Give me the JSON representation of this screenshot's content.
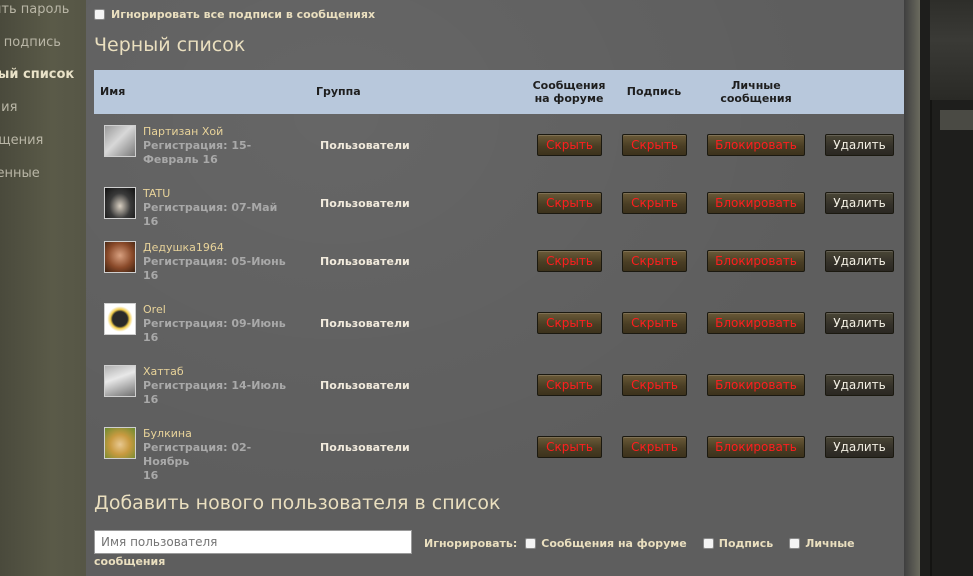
{
  "sidebar": {
    "items": [
      {
        "label": "Изменить пароль"
      },
      {
        "label": "Изменить подпись"
      },
      {
        "label": "Черный список"
      },
      {
        "label": "Уведомления"
      },
      {
        "label": "Оповещения"
      },
      {
        "label": "Сохраненные"
      }
    ]
  },
  "ignore_all_label": "Игнорировать все подписи в сообщениях",
  "blacklist": {
    "title": "Черный список",
    "headers": {
      "name": "Имя",
      "group": "Группа",
      "forum_msgs_1": "Сообщения",
      "forum_msgs_2": "на форуме",
      "signature": "Подпись",
      "pm_1": "Личные",
      "pm_2": "сообщения"
    },
    "rows": [
      {
        "name": "Партизан Хой",
        "reg1": "Регистрация: 15-",
        "reg2": "Февраль 16",
        "group": "Пользователи"
      },
      {
        "name": "TATU",
        "reg1": "Регистрация: 07-Май 16",
        "reg2": "",
        "group": "Пользователи"
      },
      {
        "name": "Дедушка1964",
        "reg1": "Регистрация: 05-Июнь",
        "reg2": "16",
        "group": "Пользователи"
      },
      {
        "name": "Orel",
        "reg1": "Регистрация: 09-Июнь",
        "reg2": "16",
        "group": "Пользователи"
      },
      {
        "name": "Хаттаб",
        "reg1": "Регистрация: 14-Июль",
        "reg2": "16",
        "group": "Пользователи"
      },
      {
        "name": "Булкина",
        "reg1": "Регистрация: 02-Ноябрь",
        "reg2": "16",
        "group": "Пользователи"
      }
    ],
    "buttons": {
      "hide": "Скрыть",
      "block": "Блокировать",
      "delete": "Удалить"
    },
    "button_text_color": "#ff1e1e"
  },
  "add_user": {
    "title": "Добавить нового пользователя в список",
    "placeholder": "Имя пользователя",
    "ignore_label": "Игнорировать:",
    "opt_forum": "Сообщения на форуме",
    "opt_signature": "Подпись",
    "opt_pm_1": "Личные",
    "opt_pm_2": "сообщения"
  }
}
